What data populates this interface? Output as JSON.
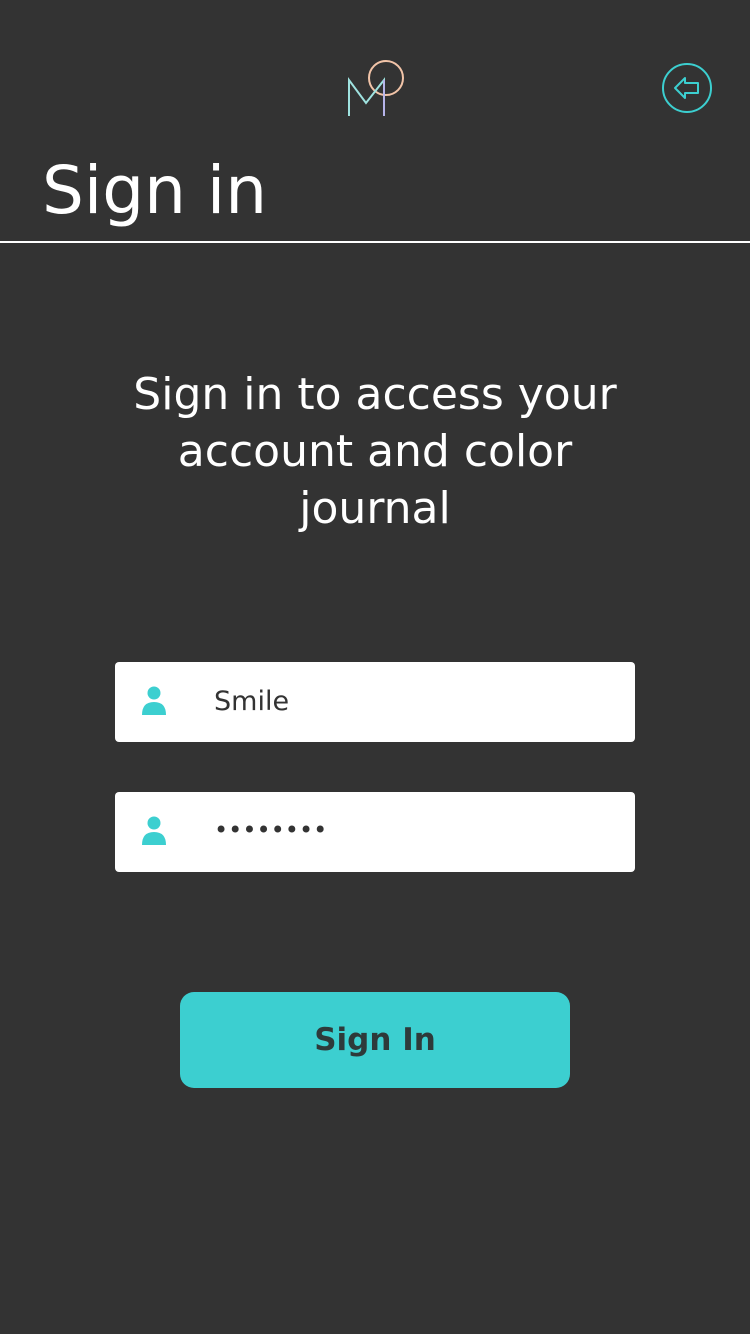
{
  "header": {
    "logo_icon": "mood-logo-icon",
    "back_icon": "back-arrow-icon",
    "title": "Sign in"
  },
  "intro": {
    "text": "Sign in to access your account and color journal"
  },
  "form": {
    "username": {
      "icon": "user-icon",
      "value": "Smile"
    },
    "password": {
      "icon": "user-icon",
      "value": "••••••••"
    },
    "submit_label": "Sign In"
  },
  "colors": {
    "background": "#333333",
    "accent": "#3ccfd0",
    "field_background": "#ffffff",
    "text_primary": "#ffffff",
    "button_text": "#2e3a3a"
  }
}
